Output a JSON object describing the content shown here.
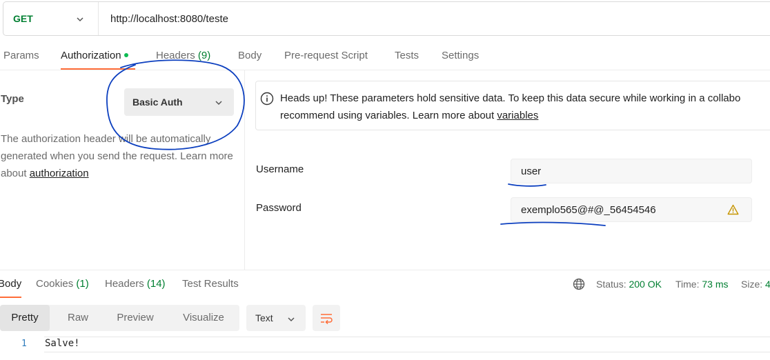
{
  "request": {
    "method": "GET",
    "url": "http://localhost:8080/teste"
  },
  "tabs": [
    {
      "label": "Params"
    },
    {
      "label": "Authorization"
    },
    {
      "label": "Headers",
      "count": "(9)"
    },
    {
      "label": "Body"
    },
    {
      "label": "Pre-request Script"
    },
    {
      "label": "Tests"
    },
    {
      "label": "Settings"
    }
  ],
  "auth": {
    "type_label": "Type",
    "type_value": "Basic Auth",
    "desc_text": "The authorization header will be automatically generated when you send the request. Learn more about ",
    "desc_link": "authorization"
  },
  "notice": {
    "line1": "Heads up! These parameters hold sensitive data. To keep this data secure while working in a collabo",
    "line2_prefix": "recommend using variables. Learn more about ",
    "line2_link": "variables"
  },
  "fields": {
    "username_label": "Username",
    "username_value": "user",
    "password_label": "Password",
    "password_value": "exemplo565@#@_56454546"
  },
  "response": {
    "tabs": [
      {
        "label": "Body"
      },
      {
        "label": "Cookies",
        "count": "(1)"
      },
      {
        "label": "Headers",
        "count": "(14)"
      },
      {
        "label": "Test Results"
      }
    ],
    "status_label": "Status:",
    "status_value": "200 OK",
    "time_label": "Time:",
    "time_value": "73 ms",
    "size_label": "Size:",
    "size_value": "4",
    "views": [
      "Pretty",
      "Raw",
      "Preview",
      "Visualize"
    ],
    "format": "Text",
    "line_number": "1",
    "body_text": "Salve!"
  },
  "colors": {
    "accent": "#ff6c37",
    "method_green": "#007f31",
    "status_green": "#007f31",
    "annotation_blue": "#0c3fbf"
  }
}
